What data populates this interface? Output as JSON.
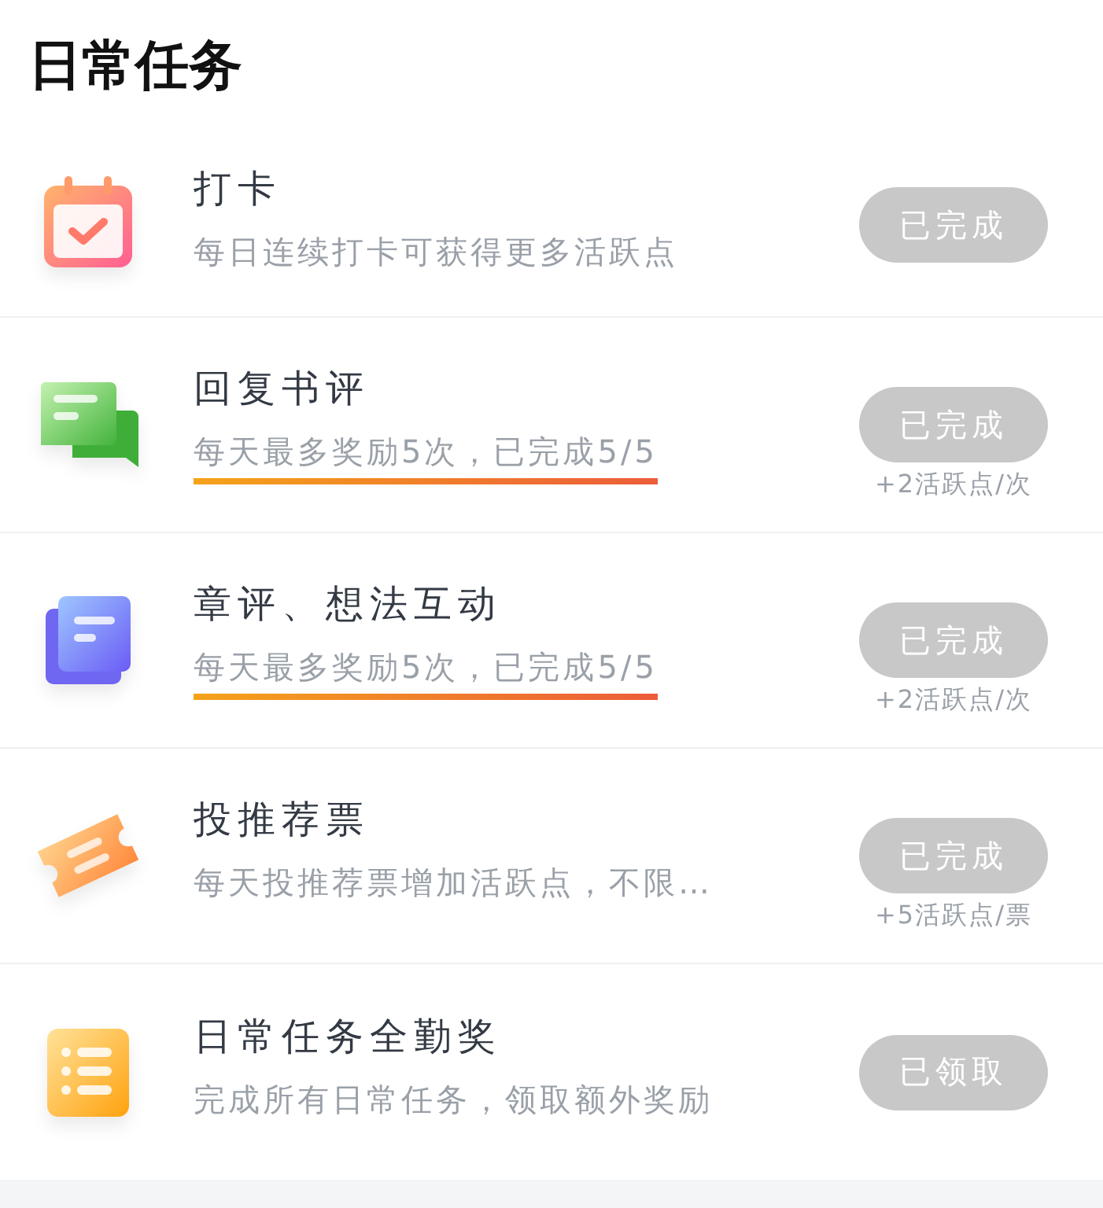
{
  "header": {
    "title": "日常任务"
  },
  "tasks": [
    {
      "kind": "calendar",
      "title": "打卡",
      "subtitle": "每日连续打卡可获得更多活跃点",
      "underlined": false,
      "button": "已完成",
      "completed": true
    },
    {
      "kind": "chat",
      "title": "回复书评",
      "subtitle": "每天最多奖励5次，已完成5/5",
      "underlined": true,
      "button": "已完成",
      "completed": true,
      "reward": "+2活跃点/次"
    },
    {
      "kind": "document",
      "title": "章评、想法互动",
      "subtitle": "每天最多奖励5次，已完成5/5",
      "underlined": true,
      "button": "已完成",
      "completed": true,
      "reward": "+2活跃点/次"
    },
    {
      "kind": "ticket",
      "title": "投推荐票",
      "subtitle": "每天投推荐票增加活跃点，不限…",
      "underlined": false,
      "button": "已完成",
      "completed": true,
      "reward": "+5活跃点/票"
    },
    {
      "kind": "list",
      "title": "日常任务全勤奖",
      "subtitle": "完成所有日常任务，领取额外奖励",
      "underlined": false,
      "button": "已领取",
      "completed": true
    }
  ]
}
